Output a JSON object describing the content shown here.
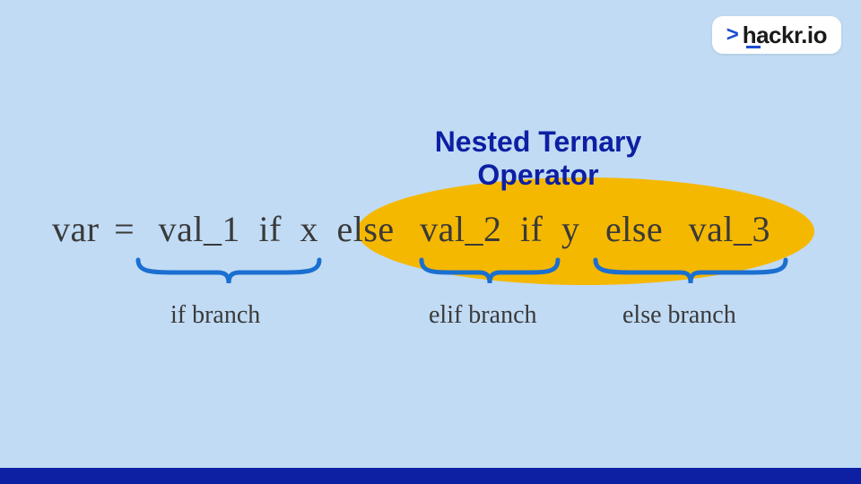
{
  "logo": {
    "chevron": ">",
    "text": "hackr.io"
  },
  "title_line1": "Nested Ternary",
  "title_line2": "Operator",
  "expression": {
    "lhs": "var",
    "eq": "=",
    "val1": "val_1",
    "if": "if",
    "x": "x",
    "else1": "else",
    "val2": "val_2",
    "if2": "if",
    "y": "y",
    "else2": "else",
    "val3": "val_3"
  },
  "branches": {
    "if_label": "if branch",
    "elif_label": "elif branch",
    "else_label": "else branch"
  },
  "colors": {
    "bg": "#c1dbf4",
    "accent_blue": "#0d1fa3",
    "brace_blue": "#1a6fd1",
    "highlight": "#f5b800",
    "text": "#3a3a3a"
  }
}
